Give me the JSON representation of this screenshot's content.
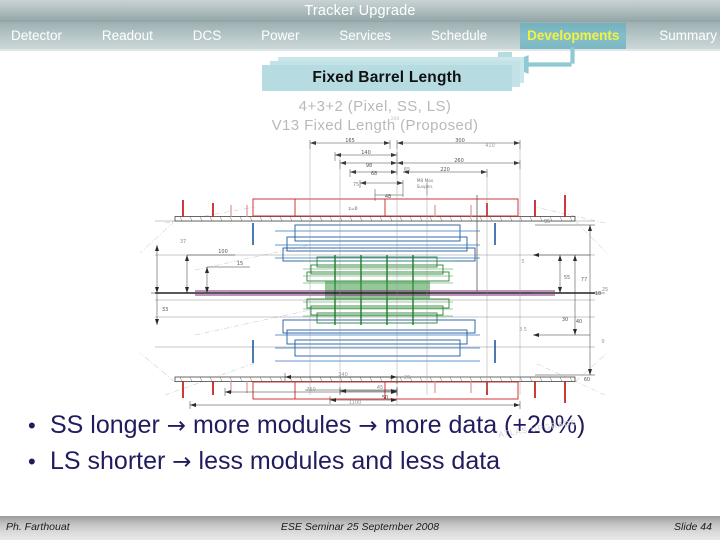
{
  "header": {
    "deck_title": "Tracker Upgrade",
    "nav": [
      {
        "label": "Detector",
        "active": false
      },
      {
        "label": "Readout",
        "active": false
      },
      {
        "label": "DCS",
        "active": false
      },
      {
        "label": "Power",
        "active": false
      },
      {
        "label": "Services",
        "active": false
      },
      {
        "label": "Schedule",
        "active": false
      },
      {
        "label": "Developments",
        "active": true
      },
      {
        "label": "Summary",
        "active": false
      }
    ],
    "active_nav_color": "#f2f240",
    "active_nav_bg": "#7cb8c3",
    "title_text_color": "#ffffff"
  },
  "slide": {
    "title": "Fixed Barrel Length",
    "title_box_color": "#b6dce2",
    "callout_arrow_color": "#8ecad3"
  },
  "drawing": {
    "caption_line_1": "4+3+2  (Pixel, SS, LS)",
    "caption_line_2": "V13  Fixed Length  (Proposed)",
    "center_label": "z=0",
    "suspension_label_1": "MB Max",
    "suspension_label_2": "Suspen.",
    "dim_top": [
      "165",
      "300",
      "410",
      "140",
      "98",
      "260",
      "68",
      "65",
      "220",
      "75",
      "48"
    ],
    "dim_left": [
      "37",
      "100",
      "15",
      "33"
    ],
    "dim_right": [
      "95",
      "55",
      "77",
      "18",
      "25",
      "30",
      "40",
      "60",
      "5",
      "3.5",
      "9"
    ],
    "dim_bottom": [
      "45",
      "50",
      "340",
      "20"
    ],
    "layer_colors": {
      "pixel": "#7a1f1f",
      "short_strip": "#1f5aa0",
      "long_strip": "#1f7a2a",
      "support": "#7a2a7a",
      "outer": "#cc2222"
    }
  },
  "bullets": [
    {
      "marker": "•",
      "segments": [
        "SS longer ",
        "→",
        " more modules ",
        "→",
        " more data (+20%)"
      ]
    },
    {
      "marker": "•",
      "segments": [
        "LS shorter ",
        "→",
        " less modules and less data"
      ]
    }
  ],
  "bullet_text_color": "#211c5e",
  "watermark": "ATLAS UPGRADE",
  "footer": {
    "author": "Ph. Farthouat",
    "event": "ESE Seminar 25 September 2008",
    "slide_number": "Slide  44"
  }
}
